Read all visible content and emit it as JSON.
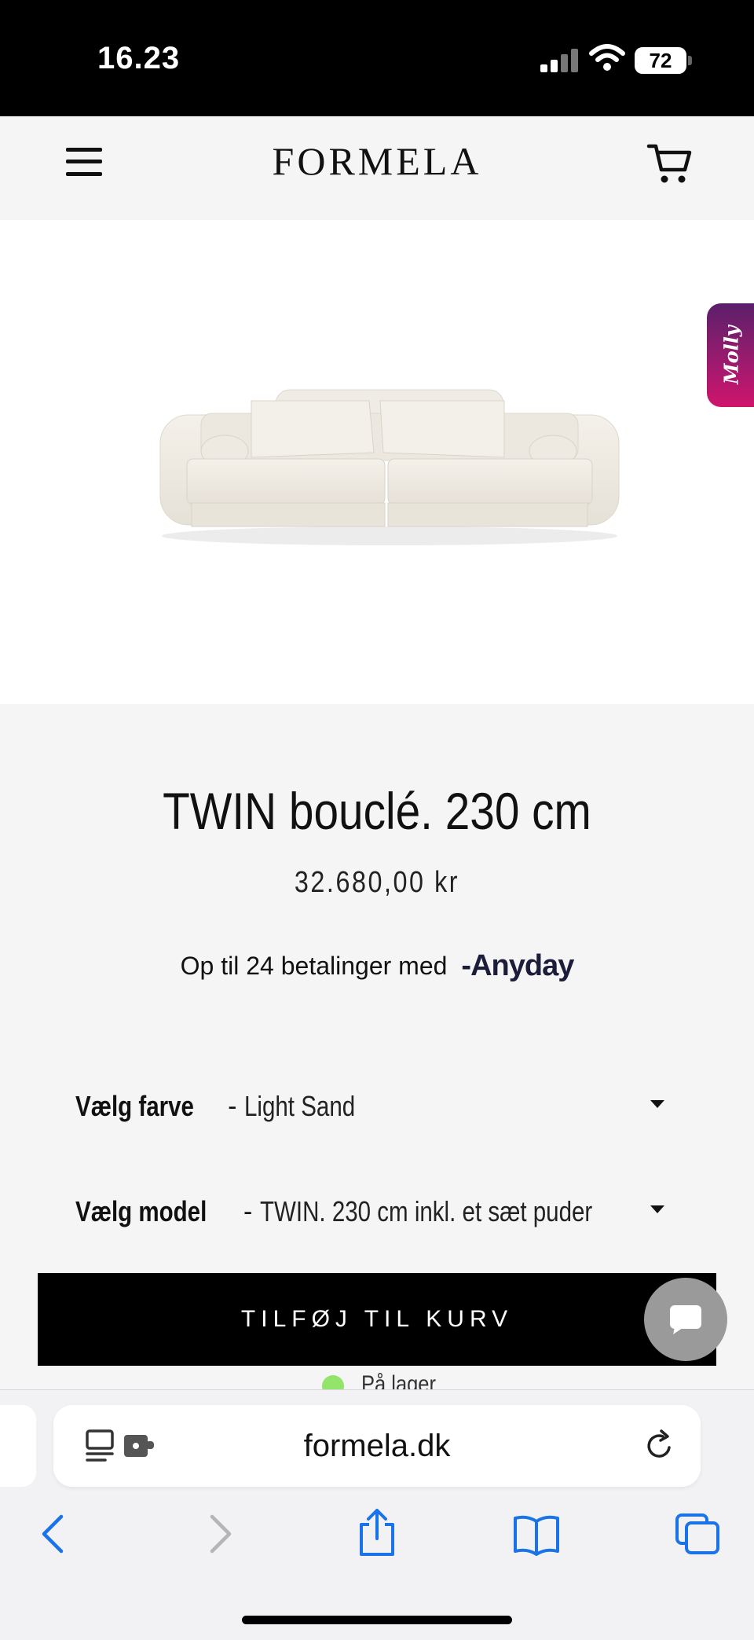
{
  "status_bar": {
    "time": "16.23",
    "battery": "72"
  },
  "header": {
    "logo": "FORMELA",
    "icons": [
      "menu-icon",
      "cart-icon"
    ]
  },
  "side_tab": {
    "label": "Molly"
  },
  "product": {
    "title": "TWIN bouclé. 230 cm",
    "price": "32.680,00 kr",
    "payment_text": "Op til 24 betalinger med",
    "payment_brand": "Anyday"
  },
  "options": [
    {
      "label": "Vælg farve",
      "separator": "-",
      "value": "Light Sand"
    },
    {
      "label": "Vælg model",
      "separator": "-",
      "value": "TWIN. 230 cm inkl. et sæt puder"
    }
  ],
  "cta": {
    "add_to_cart": "TILFØJ TIL KURV"
  },
  "stock": {
    "text": "På lager",
    "color": "#93e46b"
  },
  "browser": {
    "url": "formela.dk",
    "accent": "#1a73e8",
    "icons": [
      "reader-icon",
      "extension-icon",
      "reload-icon",
      "back-icon",
      "forward-icon",
      "share-icon",
      "bookmarks-icon",
      "tabs-icon"
    ]
  }
}
